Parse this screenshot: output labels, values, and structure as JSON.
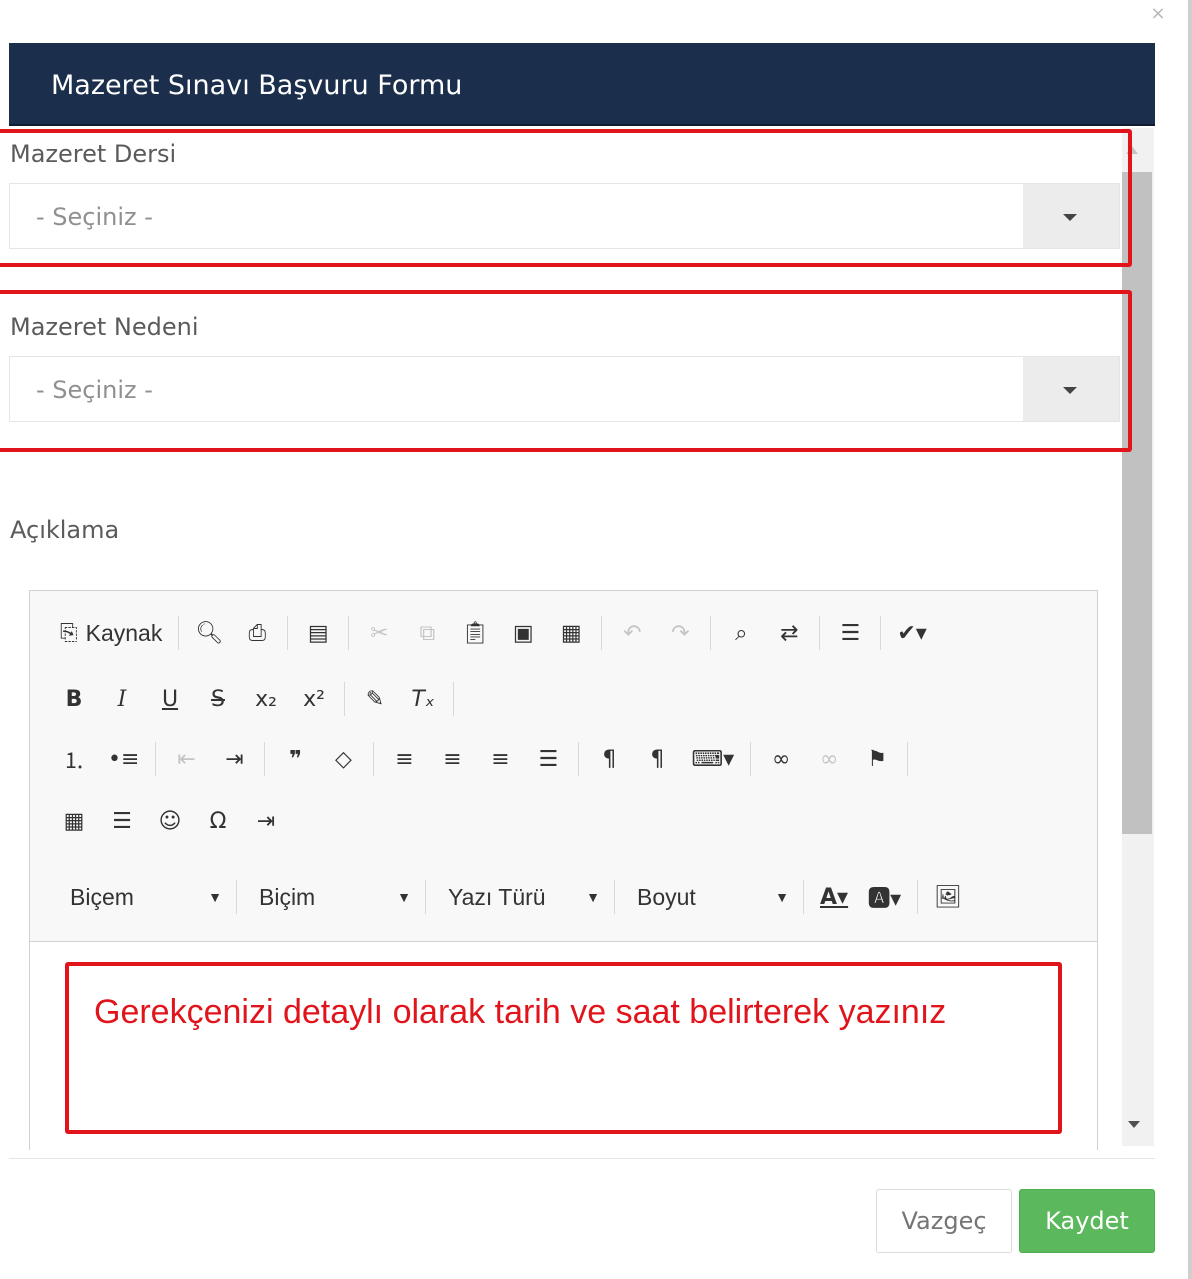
{
  "modal": {
    "close_glyph": "×",
    "title": "Mazeret Sınavı Başvuru Formu"
  },
  "form": {
    "course": {
      "label": "Mazeret Dersi",
      "value": "- Seçiniz -"
    },
    "reason": {
      "label": "Mazeret Nedeni",
      "value": "- Seçiniz -"
    },
    "description": {
      "label": "Açıklama"
    }
  },
  "editor": {
    "source_label": "Kaynak",
    "combos": {
      "style": "Biçem",
      "format": "Biçim",
      "font": "Yazı Türü",
      "size": "Boyut"
    },
    "content_text": "Gerekçenizi detaylı olarak tarih ve saat belirterek yazınız"
  },
  "footer": {
    "cancel_label": "Vazgeç",
    "save_label": "Kaydet"
  },
  "colors": {
    "header_bg": "#1b2e4c",
    "highlight_red": "#e1141b",
    "save_green": "#5cb85c"
  }
}
